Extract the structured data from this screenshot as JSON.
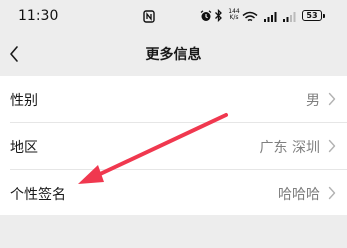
{
  "status_bar": {
    "time": "11:30",
    "network_speed_value": "144",
    "network_speed_unit": "K/s",
    "battery_level": "53",
    "icons": [
      "nfc-icon",
      "alarm-icon",
      "bluetooth-icon",
      "wifi-icon",
      "signal-icon",
      "signal-icon",
      "battery-icon"
    ]
  },
  "nav": {
    "title": "更多信息",
    "back_icon": "chevron-left-icon"
  },
  "rows": [
    {
      "label": "性别",
      "value": "男"
    },
    {
      "label": "地区",
      "value": "广东 深圳"
    },
    {
      "label": "个性签名",
      "value": "哈哈哈"
    }
  ],
  "annotation": {
    "type": "red-arrow",
    "points_to": "个性签名",
    "color": "#f0384f"
  },
  "colors": {
    "background": "#ededed",
    "card": "#ffffff",
    "label_text": "#191919",
    "value_text": "#7f7f7f",
    "divider": "#e6e6e6"
  }
}
